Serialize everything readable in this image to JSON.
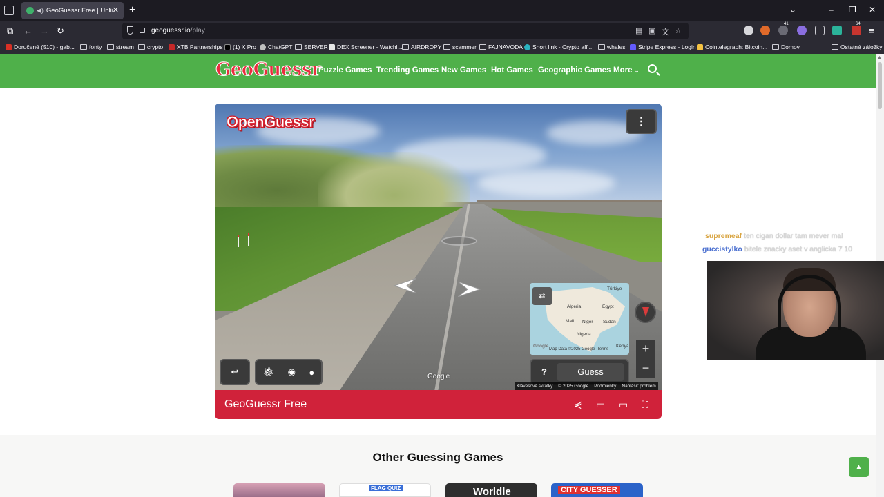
{
  "browser": {
    "tab_title": "GeoGuessr Free | Unlimited",
    "url_host": "geoguessr.io",
    "url_path": "/play",
    "bookmarks": [
      "Doručené (510) - gab...",
      "fonty",
      "stream",
      "crypto",
      "XTB Partnerships",
      "(1) X Pro",
      "ChatGPT",
      "SERVER",
      "DEX Screener - Watchl...",
      "AIRDROPY",
      "scammer",
      "FAJNAVODA",
      "Short link - Crypto affi...",
      "whales",
      "Stripe Express - Login",
      "Cointelegraph: Bitcoin...",
      "Domov"
    ],
    "other_bookmarks": "Ostatné záložky",
    "extension_badges": [
      "41",
      "64"
    ]
  },
  "site": {
    "logo": "GeoGuessr",
    "menu": [
      "Puzzle Games",
      "Trending Games",
      "New Games",
      "Hot Games",
      "Geographic Games",
      "More"
    ]
  },
  "game": {
    "overlay_logo": "OpenGuessr",
    "google_watermark": "Google",
    "minimap": {
      "labels": [
        "Türkiye",
        "Algeria",
        "Egypt",
        "Mali",
        "Niger",
        "Sudan",
        "Nigeria",
        "Kenya"
      ],
      "footer": "Map Data ©2025 Google",
      "terms": "Terms",
      "google_mark": "Google"
    },
    "guess_label": "Guess",
    "help_label": "?",
    "map_footer": [
      "Klávesové skratky",
      "© 2025 Google",
      "Podmienky",
      "Nahlásiť problém"
    ],
    "title": "GeoGuessr Free"
  },
  "section": {
    "other_title": "Other Guessing Games",
    "cards": [
      "",
      "FLAG QUIZ",
      "Worldle",
      "CITY GUESSER"
    ]
  },
  "chat": [
    {
      "user": "supremeaf",
      "message": "ten cigan dollar tam mever mal",
      "color": "#d9a542"
    },
    {
      "user": "guccistylko",
      "message": "bitele znacky aset v anglicka 7 10",
      "color": "#4a6fd0"
    }
  ],
  "colors": {
    "header_green": "#4fb04a",
    "footer_red": "#d0223a",
    "logo_red": "#ea2d3f"
  }
}
